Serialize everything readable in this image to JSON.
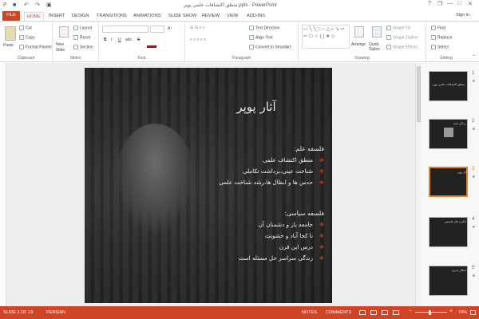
{
  "window": {
    "title": "منطق اکتشافات علمی پوپر.pptx - PowerPoint",
    "controls": {
      "help": "?",
      "restore": "❐",
      "minimize": "—",
      "maximize": "□",
      "close": "✕"
    }
  },
  "quick_access": {
    "save_icon": "■",
    "undo_icon": "↶",
    "redo_icon": "↷",
    "start_icon": "▣"
  },
  "tabs": [
    "FILE",
    "HOME",
    "INSERT",
    "DESIGN",
    "TRANSITIONS",
    "ANIMATIONS",
    "SLIDE SHOW",
    "REVIEW",
    "VIEW",
    "ADD-INS"
  ],
  "active_tab": "HOME",
  "signin": "Sign in",
  "ribbon": {
    "clipboard": {
      "paste": "Paste",
      "cut": "Cut",
      "copy": "Copy",
      "format_painter": "Format Painter",
      "label": "Clipboard"
    },
    "slides": {
      "new_slide": "New Slide",
      "layout": "Layout",
      "reset": "Reset",
      "section": "Section",
      "label": "Slides"
    },
    "font": {
      "label": "Font",
      "bold": "B",
      "italic": "I",
      "underline": "U",
      "strike": "S",
      "shadow": "abc"
    },
    "paragraph": {
      "text_direction": "Text Direction",
      "align_text": "Align Text",
      "convert": "Convert to SmartArt",
      "label": "Paragraph"
    },
    "drawing": {
      "arrange": "Arrange",
      "quick_styles": "Quick Styles",
      "shape_fill": "Shape Fill",
      "shape_outline": "Shape Outline",
      "shape_effects": "Shape Effects",
      "label": "Drawing"
    },
    "editing": {
      "find": "Find",
      "replace": "Replace",
      "select": "Select",
      "label": "Editing"
    }
  },
  "slide": {
    "title": "آثار پوپر",
    "section1": {
      "heading": "فلسفه علم:",
      "bullets": [
        "منطق اکتشاف علمی",
        "شناخت عینی،برداشت تکاملی",
        "حدس ها و ابطال ها،رشد شناخت علمی"
      ]
    },
    "section2": {
      "heading": "فلسفه سیاسی:",
      "bullets": [
        "جامعه باز و دشمنان آن",
        "نا کجا آباد و خشونت",
        "درس این قرن",
        "زندگی سراسر حل مسئله است"
      ]
    }
  },
  "thumbnails": [
    {
      "num": "1",
      "title": "منطق اکتشافات علمی پوپر"
    },
    {
      "num": "2",
      "title": "زندگی نامه"
    },
    {
      "num": "3",
      "title": "آثار پوپر"
    },
    {
      "num": "4",
      "title": "انگیزه های فلسفی"
    },
    {
      "num": "5",
      "title": "ابطال پذیری"
    }
  ],
  "star_glyph": "★",
  "bullet_glyph": "❖",
  "status": {
    "slide": "SLIDE 3 OF 19",
    "language": "PERSIAN",
    "notes": "NOTES",
    "comments": "COMMENTS",
    "zoom": "74%",
    "zoom_minus": "−",
    "zoom_plus": "+"
  },
  "colors": {
    "accent": "#d04525",
    "thumb_selected": "#e67e22",
    "bullet": "#c0392b"
  }
}
